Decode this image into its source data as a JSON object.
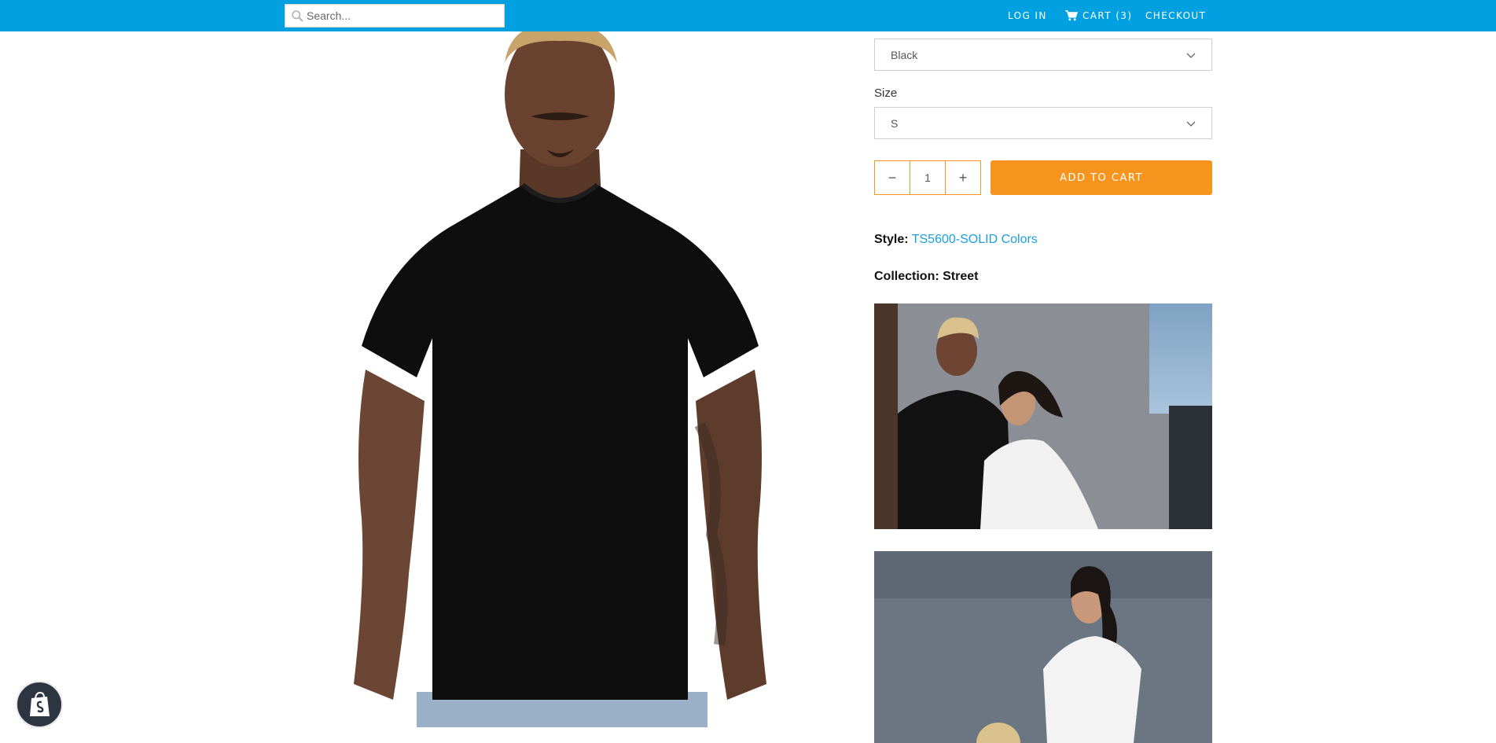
{
  "header": {
    "search_placeholder": "Search...",
    "login_label": "LOG IN",
    "cart_label": "CART (3)",
    "checkout_label": "CHECKOUT",
    "bar_color": "#00a0e1"
  },
  "product": {
    "color_select": {
      "selected": "Black"
    },
    "size_label": "Size",
    "size_select": {
      "selected": "S"
    },
    "quantity": "1",
    "decrement_symbol": "−",
    "increment_symbol": "+",
    "add_to_cart_label": "ADD TO CART",
    "accent_color": "#f7941d",
    "style_key": "Style:",
    "style_value": "TS5600-SOLID Colors",
    "collection_key": "Collection:",
    "collection_value": "Street"
  },
  "icons": {
    "search": "search-icon",
    "cart": "cart-icon",
    "chevron": "chevron-down-icon",
    "shopify": "shopify-bag-icon"
  }
}
